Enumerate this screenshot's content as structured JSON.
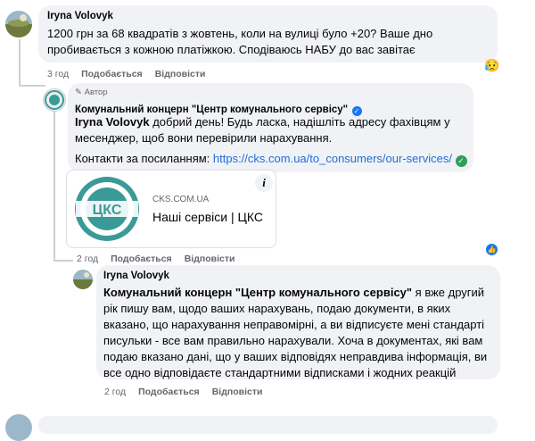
{
  "comment1": {
    "author": "Iryna Volovyk",
    "text": "1200 грн за 68 квадратів з жовтень, коли на вулиці було +20? Ваше дно пробивається з кожною платіжкою. Сподіваюсь НАБУ до вас завітає",
    "time": "3 год",
    "like": "Подобається",
    "reply": "Відповісти",
    "reaction": "😥"
  },
  "reply1": {
    "badge": "Автор",
    "author": "Комунальний концерн \"Центр комунального сервісу\"",
    "mention": "Iryna Volovyk",
    "text": " добрий день! Будь ласка, надішліть адресу фахівцям у месенджер, щоб вони перевірили нарахування.",
    "contacts_label": "Контакти за посиланням: ",
    "link": "https://cks.com.ua/to_consumers/our-services/",
    "card": {
      "logo_text": "ЦКС",
      "domain": "CKS.COM.UA",
      "title": "Наші сервіси | ЦКС",
      "info": "i"
    },
    "time": "2 год",
    "like": "Подобається",
    "reply": "Відповісти"
  },
  "reply2": {
    "author": "Iryna Volovyk",
    "mention": "Комунальний концерн \"Центр комунального сервісу\"",
    "text": " я вже другий рік пишу вам, щодо ваших нарахувань, подаю документи, в яких вказано, що нарахування неправомірні, а ви відписуєте мені стандарті писульки - все вам правильно нарахували. Хоча в документах, які вам подаю вказано дані, що у ваших відповідях неправдива інформація, ви все одно відповідаєте стандартними відписками і жодних реакцій",
    "time": "2 год",
    "like": "Подобається",
    "reply": "Відповісти"
  },
  "colors": {
    "link": "#216fdb",
    "bubble": "#f0f2f5",
    "meta": "#65676b",
    "verified": "#1877f2",
    "logo": "#3a9a97"
  }
}
